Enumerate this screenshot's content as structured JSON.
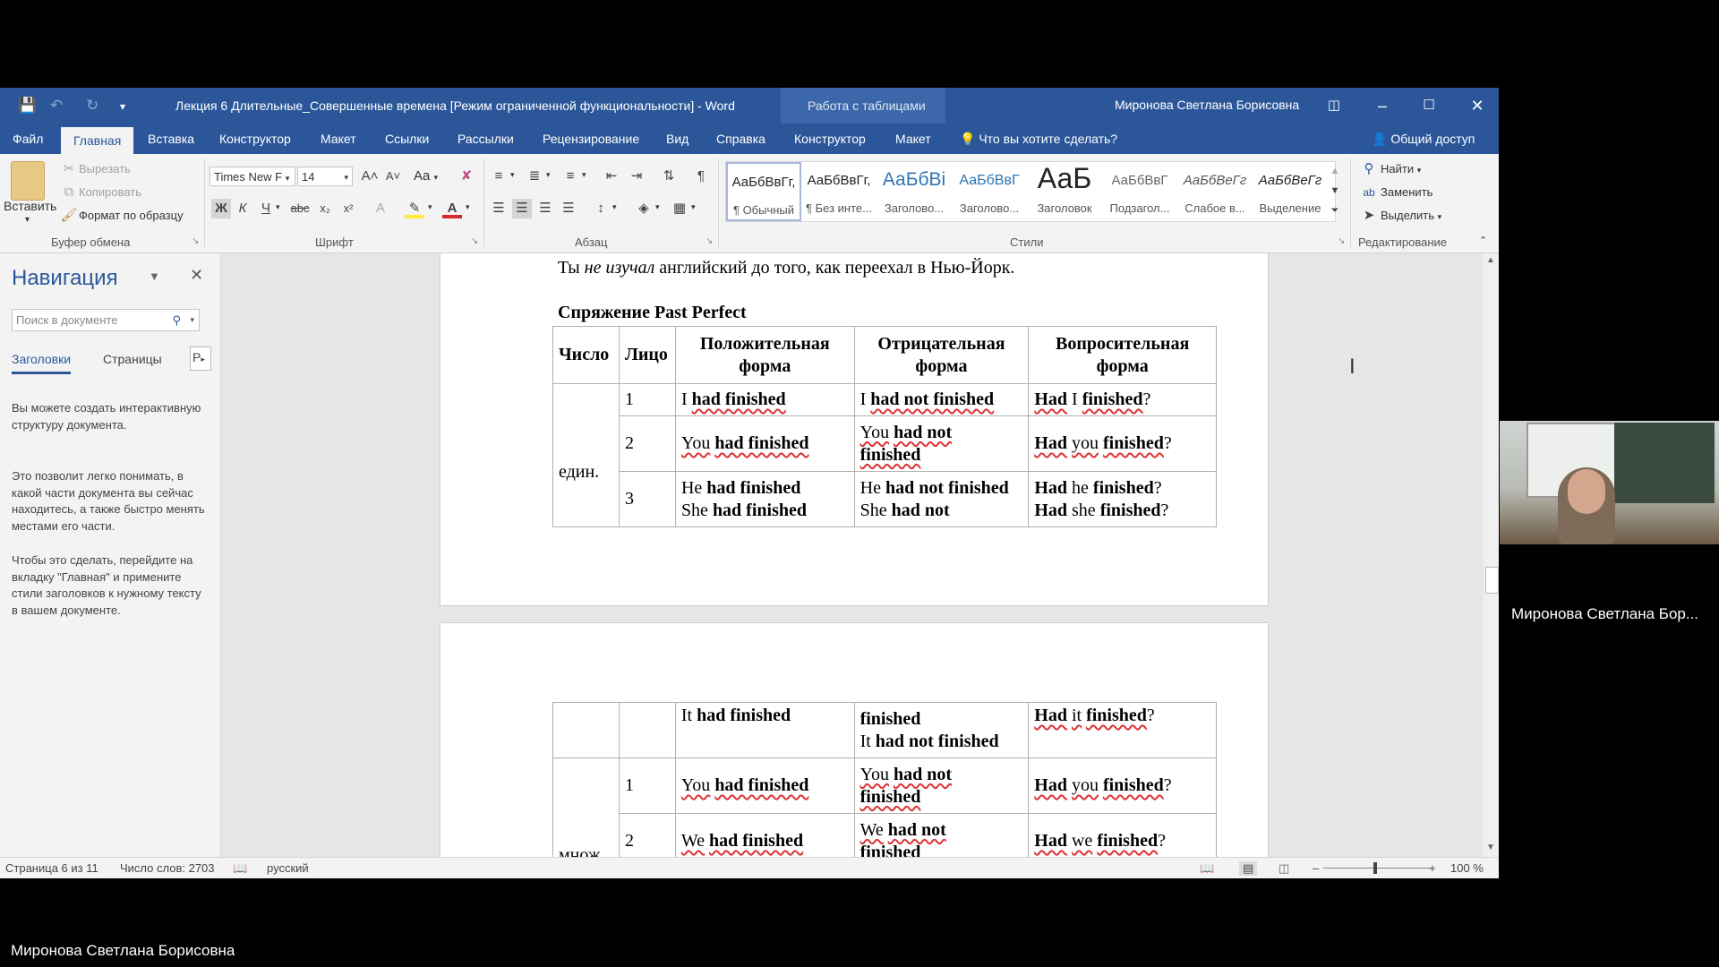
{
  "window": {
    "title": "Лекция 6 Длительные_Совершенные времена [Режим ограниченной функциональности]  -  Word",
    "context_tab": "Работа с таблицами",
    "user": "Миронова Светлана Борисовна"
  },
  "tabs": [
    "Файл",
    "Главная",
    "Вставка",
    "Конструктор",
    "Макет",
    "Ссылки",
    "Рассылки",
    "Рецензирование",
    "Вид",
    "Справка",
    "Конструктор",
    "Макет"
  ],
  "tell_me": "Что вы хотите сделать?",
  "share": "Общий доступ",
  "ribbon": {
    "clipboard": {
      "paste": "Вставить",
      "cut": "Вырезать",
      "copy": "Копировать",
      "format_painter": "Формат по образцу",
      "label": "Буфер обмена"
    },
    "font": {
      "name": "Times New F",
      "size": "14",
      "label": "Шрифт",
      "case": "Aa"
    },
    "paragraph": {
      "label": "Абзац"
    },
    "styles": {
      "label": "Стили",
      "items": [
        {
          "preview": "АаБбВвГг,",
          "name": "¶ Обычный"
        },
        {
          "preview": "АаБбВвГг,",
          "name": "¶ Без инте..."
        },
        {
          "preview": "АаБбВі",
          "name": "Заголово..."
        },
        {
          "preview": "АаБбВвГ",
          "name": "Заголово..."
        },
        {
          "preview": "АаБ",
          "name": "Заголовок"
        },
        {
          "preview": "АаБбВвГ",
          "name": "Подзагол..."
        },
        {
          "preview": "АаБбВеГг",
          "name": "Слабое в..."
        },
        {
          "preview": "АаБбВеГг",
          "name": "Выделение"
        }
      ]
    },
    "editing": {
      "find": "Найти",
      "replace": "Заменить",
      "select": "Выделить",
      "label": "Редактирование"
    }
  },
  "nav": {
    "title": "Навигация",
    "search_placeholder": "Поиск в документе",
    "tabs": [
      "Заголовки",
      "Страницы",
      "Р"
    ],
    "para1": "Вы можете создать интерактивную структуру документа.",
    "para2": "Это позволит легко понимать, в какой части документа вы сейчас находитесь, а также быстро менять местами его части.",
    "para3": "Чтобы это сделать, перейдите на вкладку \"Главная\" и примените стили заголовков к нужному тексту в вашем документе."
  },
  "document": {
    "line_top": {
      "a": "Ты ",
      "b": "не изучал",
      "c": " английский до того, как переехал в Нью-Йорк."
    },
    "heading": "Спряжение Past Perfect",
    "headers": [
      "Число",
      "Лицо",
      "Положительная форма",
      "Отрицательная форма",
      "Вопросительная форма"
    ],
    "singular_label": "един.",
    "plural_label": "множ.",
    "persons": [
      "1",
      "2",
      "3"
    ],
    "words": {
      "i": "I",
      "you": "You",
      "you_l": "you",
      "he": "He",
      "he_l": "he",
      "she": "She",
      "she_l": "she",
      "it": "It",
      "it_l": "it",
      "we": "We",
      "we_l": "we",
      "had_finished": "had finished",
      "had_not_finished": "had not finished",
      "had_not": "had not",
      "had": "had",
      "Had": "Had",
      "finished": "finished",
      "q": "?"
    }
  },
  "status": {
    "page": "Страница 6 из 11",
    "words": "Число слов: 2703",
    "lang": "русский",
    "zoom": "100 %"
  },
  "video": {
    "name": "Миронова Светлана Бор..."
  },
  "bottom_name": "Миронова Светлана Борисовна"
}
